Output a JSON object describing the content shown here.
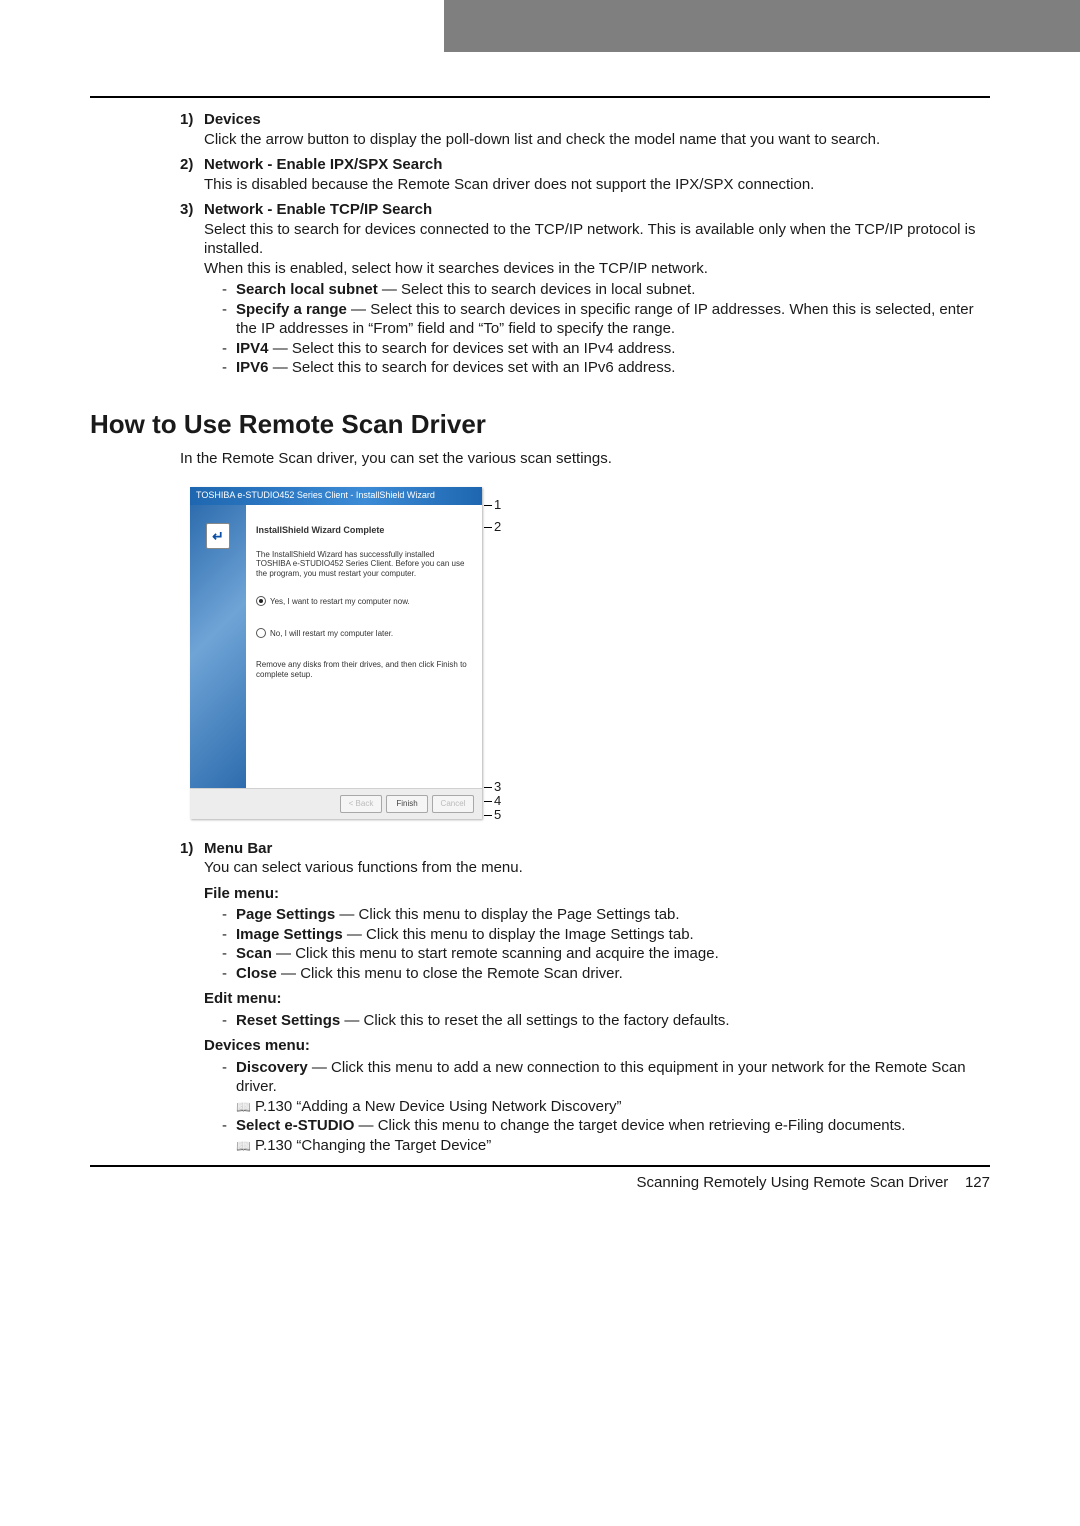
{
  "section1": {
    "items": [
      {
        "num": "1)",
        "title": "Devices",
        "text": "Click the arrow button to display the poll-down list and check the model name that you want to search."
      },
      {
        "num": "2)",
        "title": "Network - Enable IPX/SPX Search",
        "text": "This is disabled because the Remote Scan driver does not support the IPX/SPX connection."
      },
      {
        "num": "3)",
        "title": "Network - Enable TCP/IP Search",
        "text": "Select this to search for devices connected to the TCP/IP network.  This is available only when the TCP/IP protocol is installed.",
        "text2": "When this is enabled, select how it searches devices in the TCP/IP network.",
        "subs": [
          {
            "bold": "Search local subnet",
            "rest": " — Select this to search devices in local subnet."
          },
          {
            "bold": "Specify a range",
            "rest": " — Select this to search devices in specific range of IP addresses. When this is selected, enter the IP addresses in “From” field and “To” field to specify the range."
          },
          {
            "bold": "IPV4",
            "rest": " — Select this to search for devices set with an IPv4 address."
          },
          {
            "bold": "IPV6",
            "rest": " — Select this to search for devices set with an IPv6 address."
          }
        ]
      }
    ]
  },
  "h2": "How to Use Remote Scan Driver",
  "intro": "In the Remote Scan driver, you can set the various scan settings.",
  "wizard": {
    "title": "TOSHIBA e-STUDIO452 Series Client - InstallShield Wizard",
    "badge": "↵",
    "heading": "InstallShield Wizard Complete",
    "text": "The InstallShield Wizard has successfully installed TOSHIBA e-STUDIO452 Series Client.  Before you can use the program, you must restart your computer.",
    "radio_yes": "Yes, I want to restart my computer now.",
    "radio_no": "No, I will restart my computer later.",
    "note": "Remove any disks from their drives, and then click Finish to complete setup.",
    "btn_back": "< Back",
    "btn_finish": "Finish",
    "btn_cancel": "Cancel"
  },
  "callouts": {
    "c1": "1",
    "c2": "2",
    "c3": "3",
    "c4": "4",
    "c5": "5"
  },
  "section2": {
    "num": "1)",
    "title": "Menu Bar",
    "text": "You can select various functions from the menu.",
    "file_menu_label": "File menu:",
    "file_items": [
      {
        "bold": "Page Settings",
        "rest": " — Click this menu to display the Page Settings tab."
      },
      {
        "bold": "Image Settings",
        "rest": " — Click this menu to display the Image Settings tab."
      },
      {
        "bold": "Scan",
        "rest": " — Click this menu to start remote scanning and acquire the image."
      },
      {
        "bold": "Close",
        "rest": " — Click this menu to close the Remote Scan driver."
      }
    ],
    "edit_menu_label": "Edit menu:",
    "edit_items": [
      {
        "bold": "Reset Settings",
        "rest": " — Click this to reset the all settings to the factory defaults."
      }
    ],
    "devices_menu_label": "Devices menu:",
    "devices_items": [
      {
        "bold": "Discovery",
        "rest": " — Click this menu to add a new connection to this equipment in your network for the Remote Scan driver.",
        "ref": "P.130 “Adding a New Device Using Network Discovery”"
      },
      {
        "bold": "Select e-STUDIO",
        "rest": " — Click this menu to change the target device when retrieving e-Filing documents.",
        "ref": "P.130 “Changing the Target Device”"
      }
    ]
  },
  "footer": {
    "label": "Scanning Remotely Using Remote Scan Driver",
    "page": "127"
  }
}
